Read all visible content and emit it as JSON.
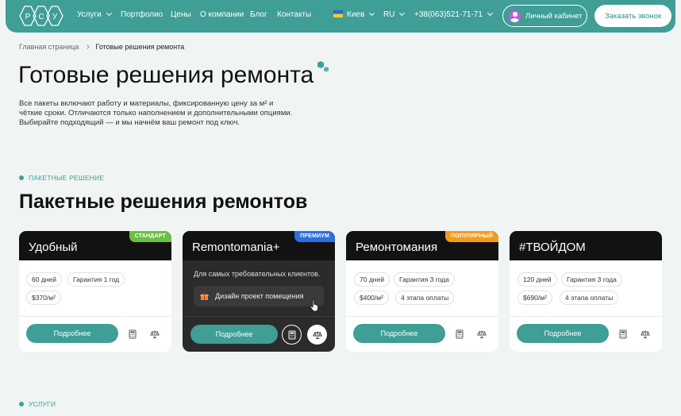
{
  "header": {
    "nav": [
      {
        "label": "Услуги",
        "has_dropdown": true
      },
      {
        "label": "Портфолио"
      },
      {
        "label": "Цены"
      },
      {
        "label": "О компании"
      },
      {
        "label": "Блог"
      },
      {
        "label": "Контакты"
      }
    ],
    "city": "Киев",
    "lang": "RU",
    "phone": "+38(063)521-71-71",
    "cabinet": "Личный кабинет",
    "callback": "Заказать звонок",
    "logo_letters": [
      "Р",
      "С",
      "У"
    ]
  },
  "breadcrumb": {
    "home": "Главная страница",
    "current": "Готовые решения ремонта"
  },
  "page_title": "Готовые решения ремонта",
  "intro": "Все пакеты включают работу и материалы, фиксированную цену за м² и чёткие сроки. Отличаются только наполнением и дополнительными опциями. Выбирайте подходящий — и мы начнём ваш ремонт под ключ.",
  "section_label": "ПАКЕТНЫЕ РЕШЕНИЕ",
  "section_title": "Пакетные решения ремонтов",
  "services_label": "УСЛУГИ",
  "cards": [
    {
      "name": "Удобный",
      "badge": "СТАНДАРТ",
      "badge_color": "#6cbf45",
      "tags": [
        "60 дней",
        "Гарантия 1 год",
        "$370/м²"
      ],
      "more": "Подробнее"
    },
    {
      "name": "Remontomania+",
      "badge": "ПРЕМИУМ",
      "badge_color": "#2d6fe0",
      "description": "Для самых требовательных клиентов.",
      "design": "Дизайн  проект  помещения",
      "more": "Подробнее"
    },
    {
      "name": "Ремонтомания",
      "badge": "ПОПУЛЯРНЫЙ",
      "badge_color": "#f39a1b",
      "tags": [
        "70 дней",
        "Гарантия 3 года",
        "$400/м²",
        "4 этапа оплаты"
      ],
      "more": "Подробнее"
    },
    {
      "name": "#ТВОЙДОМ",
      "tags": [
        "120 дней",
        "Гарантия 3 года",
        "$690/м²",
        "4 этапа оплаты"
      ],
      "more": "Подробнее"
    }
  ],
  "colors": {
    "accent": "#3f9e96",
    "dark": "#121212"
  }
}
